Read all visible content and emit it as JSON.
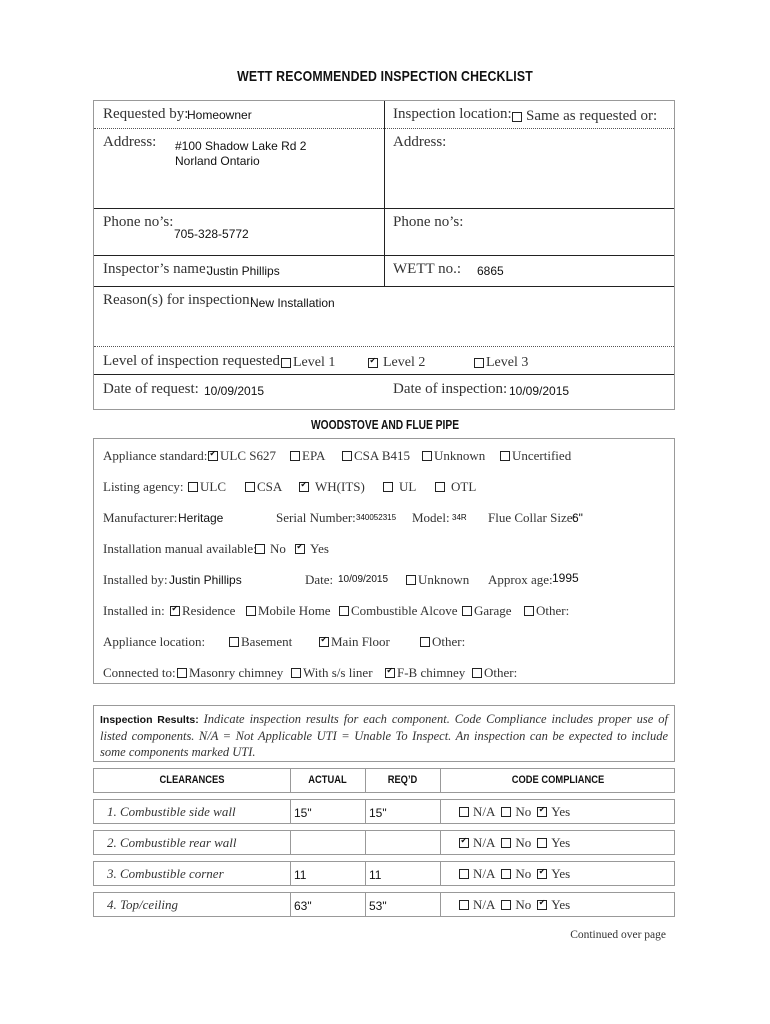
{
  "title": "WETT RECOMMENDED INSPECTION CHECKLIST",
  "header": {
    "requested_by_label": "Requested by:",
    "requested_by_value": "Homeowner",
    "inspection_location_label": "Inspection location:",
    "same_as_requested": {
      "label": "Same as requested or:",
      "checked": false
    },
    "address_label": "Address:",
    "address_line1": "#100 Shadow Lake Rd 2",
    "address_line2": "Norland Ontario",
    "address2_label": "Address:",
    "phone_label": "Phone no’s:",
    "phone_value": "705-328-5772",
    "phone2_label": "Phone no’s:",
    "inspector_label": "Inspector’s name:",
    "inspector_value": "Justin Phillips",
    "wett_label": "WETT no.:",
    "wett_value": "6865",
    "reason_label": "Reason(s) for inspection:",
    "reason_value": "New Installation",
    "level_label": "Level of inspection requested:",
    "levels": [
      {
        "label": "Level 1",
        "checked": false
      },
      {
        "label": "Level 2",
        "checked": true
      },
      {
        "label": "Level 3",
        "checked": false
      }
    ],
    "date_request_label": "Date of request:",
    "date_request_value": "10/09/2015",
    "date_inspection_label": "Date of inspection:",
    "date_inspection_value": "10/09/2015"
  },
  "woodstove": {
    "section_title": "WOODSTOVE AND FLUE PIPE",
    "appliance_standard_label": "Appliance standard:",
    "appliance_standard": [
      {
        "label": "ULC S627",
        "checked": true
      },
      {
        "label": "EPA",
        "checked": false
      },
      {
        "label": "CSA B415",
        "checked": false
      },
      {
        "label": "Unknown",
        "checked": false
      },
      {
        "label": "Uncertified",
        "checked": false
      }
    ],
    "listing_agency_label": "Listing agency:",
    "listing_agency": [
      {
        "label": "ULC",
        "checked": false
      },
      {
        "label": "CSA",
        "checked": false
      },
      {
        "label": "WH(ITS)",
        "checked": true
      },
      {
        "label": "UL",
        "checked": false
      },
      {
        "label": "OTL",
        "checked": false
      }
    ],
    "manufacturer_label": "Manufacturer:",
    "manufacturer_value": "Heritage",
    "serial_label": "Serial Number:",
    "serial_value": "340052315",
    "model_label": "Model:",
    "model_value": "34R",
    "flue_collar_label": "Flue Collar Size:",
    "flue_collar_value": "6\"",
    "manual_label": "Installation manual available:",
    "manual_options": [
      {
        "label": "No",
        "checked": false
      },
      {
        "label": "Yes",
        "checked": true
      }
    ],
    "installed_by_label": "Installed by:",
    "installed_by_value": "Justin Phillips",
    "date_label": "Date:",
    "date_value": "10/09/2015",
    "unknown": {
      "label": "Unknown",
      "checked": false
    },
    "approx_age_label": "Approx age:",
    "approx_age_value": "1995",
    "installed_in_label": "Installed in:",
    "installed_in": [
      {
        "label": "Residence",
        "checked": true
      },
      {
        "label": "Mobile Home",
        "checked": false
      },
      {
        "label": "Combustible Alcove",
        "checked": false
      },
      {
        "label": "Garage",
        "checked": false
      },
      {
        "label": "Other:",
        "checked": false
      }
    ],
    "location_label": "Appliance location:",
    "location": [
      {
        "label": "Basement",
        "checked": false
      },
      {
        "label": "Main Floor",
        "checked": true
      },
      {
        "label": "Other:",
        "checked": false
      }
    ],
    "connected_label": "Connected to:",
    "connected": [
      {
        "label": "Masonry chimney",
        "checked": false
      },
      {
        "label": "With s/s liner",
        "checked": false
      },
      {
        "label": "F-B chimney",
        "checked": true
      },
      {
        "label": "Other:",
        "checked": false
      }
    ]
  },
  "results": {
    "heading": "Inspection Results:",
    "text": " Indicate inspection results for each component. Code Compliance includes proper use of listed components. N/A = Not Applicable  UTI = Unable To Inspect. An inspection can be expected to include some components marked UTI."
  },
  "table": {
    "headers": [
      "CLEARANCES",
      "ACTUAL",
      "REQ’D",
      "CODE COMPLIANCE"
    ],
    "compliance_options": [
      "N/A",
      "No",
      "Yes"
    ],
    "rows": [
      {
        "label": "1. Combustible side wall",
        "actual": "15\"",
        "required": "15\"",
        "na": false,
        "no": false,
        "yes": true
      },
      {
        "label": "2. Combustible rear wall",
        "actual": "",
        "required": "",
        "na": true,
        "no": false,
        "yes": false
      },
      {
        "label": "3. Combustible corner",
        "actual": "11",
        "required": "11",
        "na": false,
        "no": false,
        "yes": true
      },
      {
        "label": "4. Top/ceiling",
        "actual": "63\"",
        "required": "53\"",
        "na": false,
        "no": false,
        "yes": true
      }
    ]
  },
  "footer": "Continued over page"
}
